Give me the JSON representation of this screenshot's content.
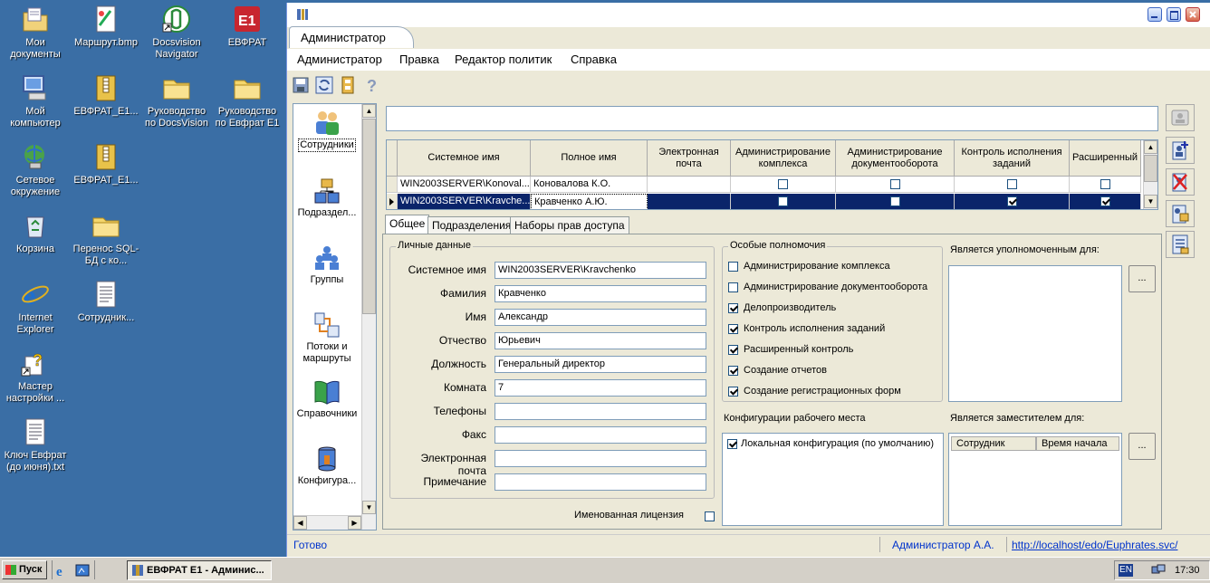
{
  "desktop": {
    "icons": [
      {
        "label": "Мои документы",
        "icon": "my-documents-icon"
      },
      {
        "label": "Маршрут.bmp",
        "icon": "bitmap-file-icon"
      },
      {
        "label": "Docsvision Navigator",
        "icon": "docsvision-icon"
      },
      {
        "label": "ЕВФРАТ",
        "icon": "evfrat-icon"
      },
      {
        "label": "Мой компьютер",
        "icon": "my-computer-icon"
      },
      {
        "label": "ЕВФРАТ_E1...",
        "icon": "archive-icon"
      },
      {
        "label": "Руководство по DocsVision",
        "icon": "folder-icon"
      },
      {
        "label": "Руководство по Евфрат E1",
        "icon": "folder-icon"
      },
      {
        "label": "Сетевое окружение",
        "icon": "network-icon"
      },
      {
        "label": "ЕВФРАТ_E1...",
        "icon": "archive-icon"
      },
      {
        "label": "Корзина",
        "icon": "recycle-bin-icon"
      },
      {
        "label": "Перенос SQL-БД с ко...",
        "icon": "folder-icon"
      },
      {
        "label": "Internet Explorer",
        "icon": "internet-explorer-icon"
      },
      {
        "label": "Сотрудник...",
        "icon": "text-file-icon"
      },
      {
        "label": "Мастер настройки ...",
        "icon": "wizard-icon"
      },
      {
        "label": "Ключ Евфрат (до июня).txt",
        "icon": "text-file-icon"
      }
    ]
  },
  "window": {
    "tab_title": "Администратор",
    "menu": [
      "Администратор",
      "Правка",
      "Редактор политик",
      "Справка"
    ],
    "toolbar_icons": [
      "save-icon",
      "refresh-icon",
      "archive-icon",
      "help-icon"
    ]
  },
  "nav": {
    "items": [
      {
        "label": "Сотрудники",
        "icon": "employees-icon"
      },
      {
        "label": "Подраздел...",
        "icon": "departments-icon"
      },
      {
        "label": "Группы",
        "icon": "groups-icon"
      },
      {
        "label": "Потоки и маршруты",
        "icon": "routes-icon"
      },
      {
        "label": "Справочники",
        "icon": "directories-icon"
      },
      {
        "label": "Конфигура...",
        "icon": "configuration-icon"
      }
    ]
  },
  "grid": {
    "columns": [
      "Системное имя",
      "Полное имя",
      "Электронная почта",
      "Администрирование комплекса",
      "Администрирование документооборота",
      "Контроль исполнения заданий",
      "Расширенный"
    ],
    "rows": [
      {
        "system_name": "WIN2003SERVER\\Konoval...",
        "full_name": "Коновалова К.О.",
        "email": "",
        "admin_complex": false,
        "admin_docflow": false,
        "task_control": false,
        "extended": false
      },
      {
        "system_name": "WIN2003SERVER\\Kravche...",
        "full_name": "Кравченко А.Ю.",
        "email": "",
        "admin_complex": false,
        "admin_docflow": false,
        "task_control": true,
        "extended": true
      }
    ]
  },
  "subtabs": [
    "Общее",
    "Подразделения",
    "Наборы прав доступа"
  ],
  "personal": {
    "title": "Личные данные",
    "fields": [
      {
        "label": "Системное имя",
        "value": "WIN2003SERVER\\Kravchenko"
      },
      {
        "label": "Фамилия",
        "value": "Кравченко"
      },
      {
        "label": "Имя",
        "value": "Александр"
      },
      {
        "label": "Отчество",
        "value": "Юрьевич"
      },
      {
        "label": "Должность",
        "value": "Генеральный директор"
      },
      {
        "label": "Комната",
        "value": "7"
      },
      {
        "label": "Телефоны",
        "value": ""
      },
      {
        "label": "Факс",
        "value": ""
      },
      {
        "label": "Электронная почта",
        "value": ""
      },
      {
        "label": "Примечание",
        "value": ""
      }
    ],
    "named_license_label": "Именованная лицензия"
  },
  "special": {
    "title": "Особые полномочия",
    "items": [
      {
        "label": "Администрирование комплекса",
        "checked": false
      },
      {
        "label": "Администрирование документооборота",
        "checked": false
      },
      {
        "label": "Делопроизводитель",
        "checked": true
      },
      {
        "label": "Контроль исполнения заданий",
        "checked": true
      },
      {
        "label": "Расширенный контроль",
        "checked": true
      },
      {
        "label": "Создание отчетов",
        "checked": true
      },
      {
        "label": "Создание регистрационных форм",
        "checked": true
      }
    ]
  },
  "workplace": {
    "title": "Конфигурации рабочего места",
    "items": [
      {
        "label": "Локальная конфигурация (по умолчанию)",
        "checked": true
      }
    ]
  },
  "authorized": {
    "title": "Является уполномоченным для:",
    "button": "..."
  },
  "deputy": {
    "title": "Является заместителем для:",
    "columns": [
      "Сотрудник",
      "Время начала"
    ],
    "button": "..."
  },
  "status": {
    "text": "Готово",
    "user": "Администратор А.А.",
    "url": "http://localhost/edo/Euphrates.svc/"
  },
  "taskbar": {
    "start": "Пуск",
    "task": "ЕВФРАТ E1 - Админис...",
    "lang": "EN",
    "time": "17:30"
  },
  "colors": {
    "desktop": "#3a6ea5",
    "selection": "#0a246a",
    "link": "#0033cc"
  }
}
